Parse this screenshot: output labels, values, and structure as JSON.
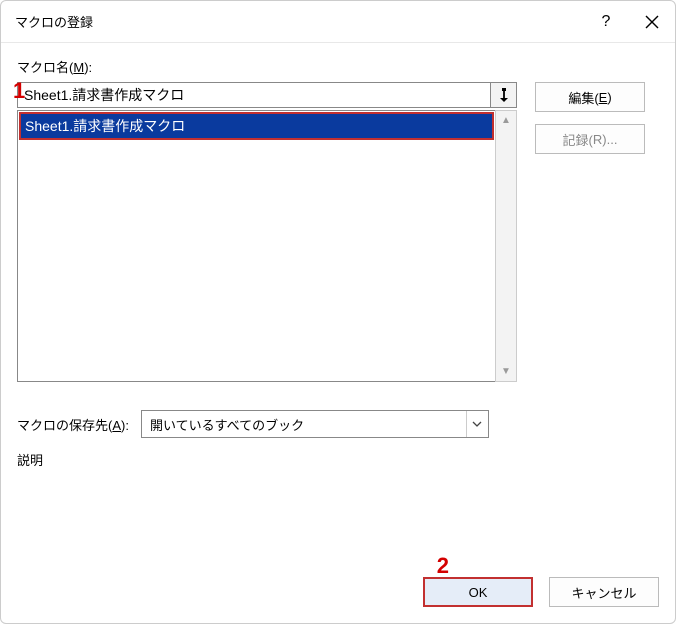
{
  "titlebar": {
    "title": "マクロの登録",
    "help_label": "?",
    "close_label": "×"
  },
  "labels": {
    "macroname_prefix": "マクロ名(",
    "macroname_key": "M",
    "macroname_suffix": "):",
    "saveloc_prefix": "マクロの保存先(",
    "saveloc_key": "A",
    "saveloc_suffix": "):",
    "description": "説明"
  },
  "macroname_value": "Sheet1.請求書作成マクロ",
  "macrolist": {
    "items": [
      "Sheet1.請求書作成マクロ"
    ]
  },
  "buttons": {
    "edit_prefix": "編集(",
    "edit_key": "E",
    "edit_suffix": ")",
    "record_prefix": "記録(",
    "record_key": "R",
    "record_suffix": ")...",
    "ok": "OK",
    "cancel": "キャンセル"
  },
  "saveloc": {
    "selected": "開いているすべてのブック"
  },
  "annotations": {
    "one": "1",
    "two": "2"
  }
}
